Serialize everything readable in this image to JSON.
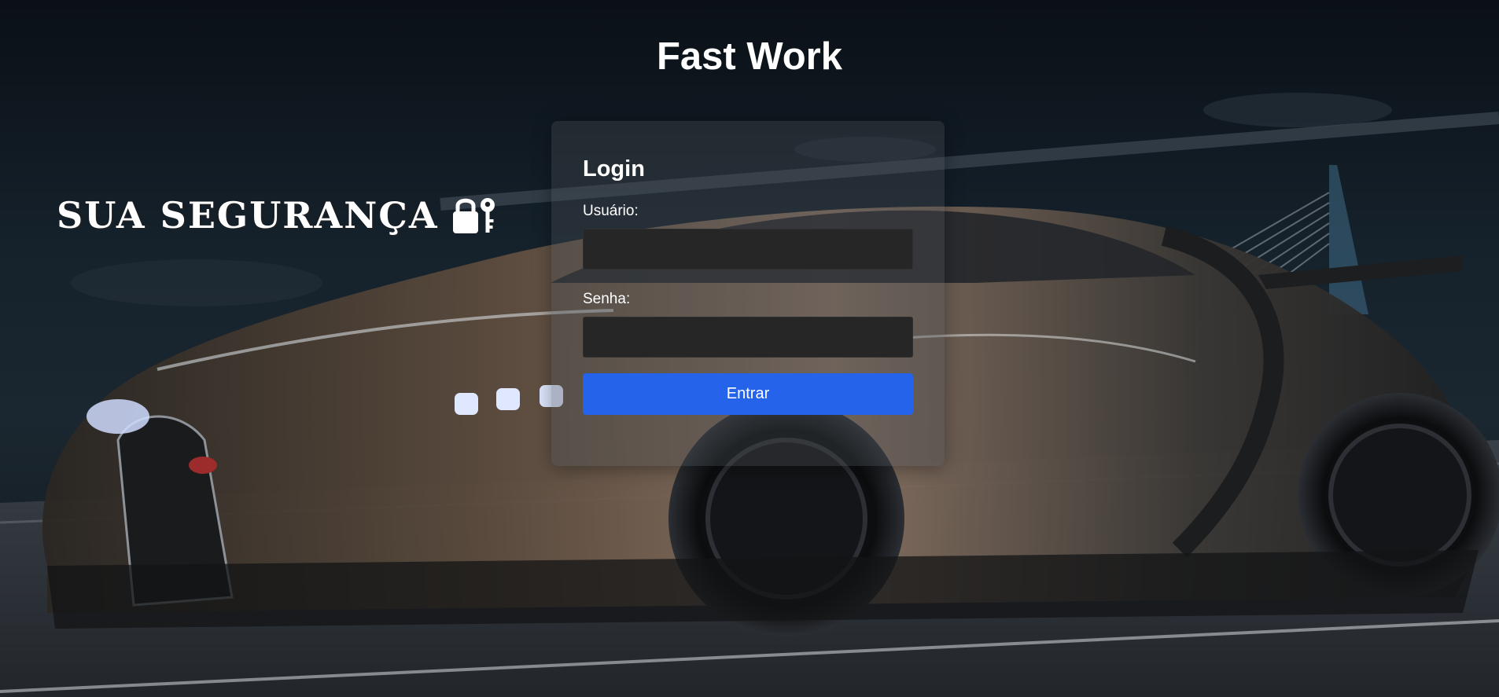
{
  "header": {
    "title": "Fast Work"
  },
  "tagline": {
    "text": "SUA SEGURANÇA",
    "icon": "lock-key-icon"
  },
  "login": {
    "heading": "Login",
    "username_label": "Usuário:",
    "username_value": "",
    "password_label": "Senha:",
    "password_value": "",
    "submit_label": "Entrar"
  },
  "colors": {
    "button": "#2563eb",
    "input_bg": "#262626",
    "text": "#ffffff"
  },
  "background": {
    "description_icon": "car-background-image"
  }
}
